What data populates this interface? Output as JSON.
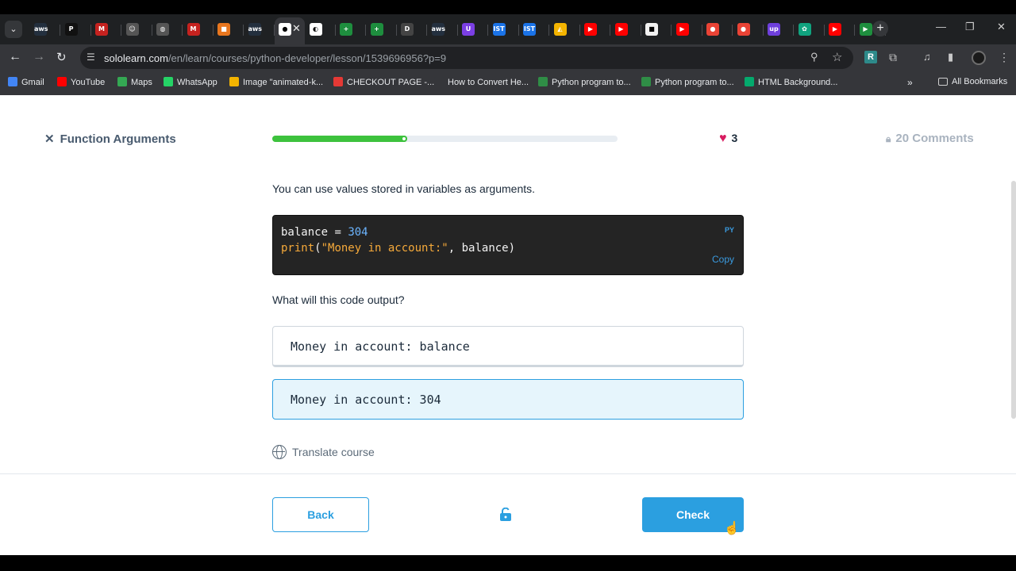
{
  "browser": {
    "tabs": [
      {
        "icon": "aws-icon",
        "glyph": "aws",
        "color": "#232f3e"
      },
      {
        "icon": "p-icon",
        "glyph": "P",
        "color": "#111111"
      },
      {
        "icon": "gmail-icon",
        "glyph": "M",
        "color": "#c5221f"
      },
      {
        "icon": "robot-icon",
        "glyph": "☺",
        "color": "#555555"
      },
      {
        "icon": "globe-icon",
        "glyph": "◍",
        "color": "#555555"
      },
      {
        "icon": "gmail-icon",
        "glyph": "M",
        "color": "#c5221f"
      },
      {
        "icon": "box-icon",
        "glyph": "■",
        "color": "#e8761e"
      },
      {
        "icon": "aws-icon",
        "glyph": "aws",
        "color": "#232f3e"
      },
      {
        "icon": "sololearn-icon",
        "glyph": "×",
        "color": "#35363a",
        "active": true
      },
      {
        "icon": "toggle-icon",
        "glyph": "◐",
        "color": "#ffffff"
      },
      {
        "icon": "sheets-icon",
        "glyph": "+",
        "color": "#1e8e3e"
      },
      {
        "icon": "sheets-icon",
        "glyph": "+",
        "color": "#1e8e3e"
      },
      {
        "icon": "d-icon",
        "glyph": "D",
        "color": "#444444"
      },
      {
        "icon": "aws-icon",
        "glyph": "aws",
        "color": "#232f3e"
      },
      {
        "icon": "shield-icon",
        "glyph": "U",
        "color": "#7b3fe4"
      },
      {
        "icon": "ist-icon",
        "glyph": "IST",
        "color": "#1a73e8"
      },
      {
        "icon": "ist-icon",
        "glyph": "IST",
        "color": "#1a73e8"
      },
      {
        "icon": "drive-icon",
        "glyph": "◭",
        "color": "#f4b400"
      },
      {
        "icon": "youtube-icon",
        "glyph": "▶",
        "color": "#ff0000"
      },
      {
        "icon": "youtube-icon",
        "glyph": "▶",
        "color": "#ff0000"
      },
      {
        "icon": "doc-icon",
        "glyph": "■",
        "color": "#f1f1f1"
      },
      {
        "icon": "youtube-icon",
        "glyph": "▶",
        "color": "#ff0000"
      },
      {
        "icon": "maps-icon",
        "glyph": "●",
        "color": "#ea4335"
      },
      {
        "icon": "maps-icon",
        "glyph": "●",
        "color": "#ea4335"
      },
      {
        "icon": "upwork-icon",
        "glyph": "up",
        "color": "#6e3fdc"
      },
      {
        "icon": "chatgpt-icon",
        "glyph": "✿",
        "color": "#10a37f"
      },
      {
        "icon": "youtube-icon",
        "glyph": "▶",
        "color": "#ff0000"
      },
      {
        "icon": "sololearn-icon",
        "glyph": "▶",
        "color": "#1e8e3e"
      }
    ],
    "url_domain": "sololearn.com",
    "url_path": "/en/learn/courses/python-developer/lesson/1539696956?p=9",
    "bookmarks": [
      {
        "label": "Gmail",
        "icon": "gmail-icon",
        "color": "#4285f4"
      },
      {
        "label": "YouTube",
        "icon": "youtube-icon",
        "color": "#ff0000"
      },
      {
        "label": "Maps",
        "icon": "maps-icon",
        "color": "#34a853"
      },
      {
        "label": "WhatsApp",
        "icon": "whatsapp-icon",
        "color": "#25d366"
      },
      {
        "label": "Image \"animated-k...",
        "icon": "star-icon",
        "color": "#f4b400"
      },
      {
        "label": "CHECKOUT PAGE -...",
        "icon": "lips-icon",
        "color": "#e53935"
      },
      {
        "label": "How to Convert He...",
        "icon": "alpha-icon",
        "color": "#35363a"
      },
      {
        "label": "Python program to...",
        "icon": "geeks-icon",
        "color": "#2f8d46"
      },
      {
        "label": "Python program to...",
        "icon": "geeks-icon",
        "color": "#2f8d46"
      },
      {
        "label": "HTML Background...",
        "icon": "w3-icon",
        "color": "#04aa6d"
      }
    ],
    "all_bookmarks": "All Bookmarks"
  },
  "lesson": {
    "title": "Function Arguments",
    "progress_fraction": 0.39,
    "likes": "3",
    "comments": "20 Comments",
    "intro": "You can use values stored in variables as arguments.",
    "code": {
      "lang": "PY",
      "copy": "Copy",
      "line1_var": "balance",
      "line1_op": " = ",
      "line1_num": "304",
      "line2_fn": "print",
      "line2_open": "(",
      "line2_str": "\"Money in account:\"",
      "line2_rest": ", balance)"
    },
    "question": "What will this code output?",
    "options": [
      "Money in account: balance",
      "Money in account: 304"
    ],
    "selected_option": 1,
    "translate": "Translate course",
    "back": "Back",
    "check": "Check"
  },
  "colors": {
    "accent": "#2b9fe0",
    "progress": "#3dc23d",
    "heart": "#d81b60"
  }
}
